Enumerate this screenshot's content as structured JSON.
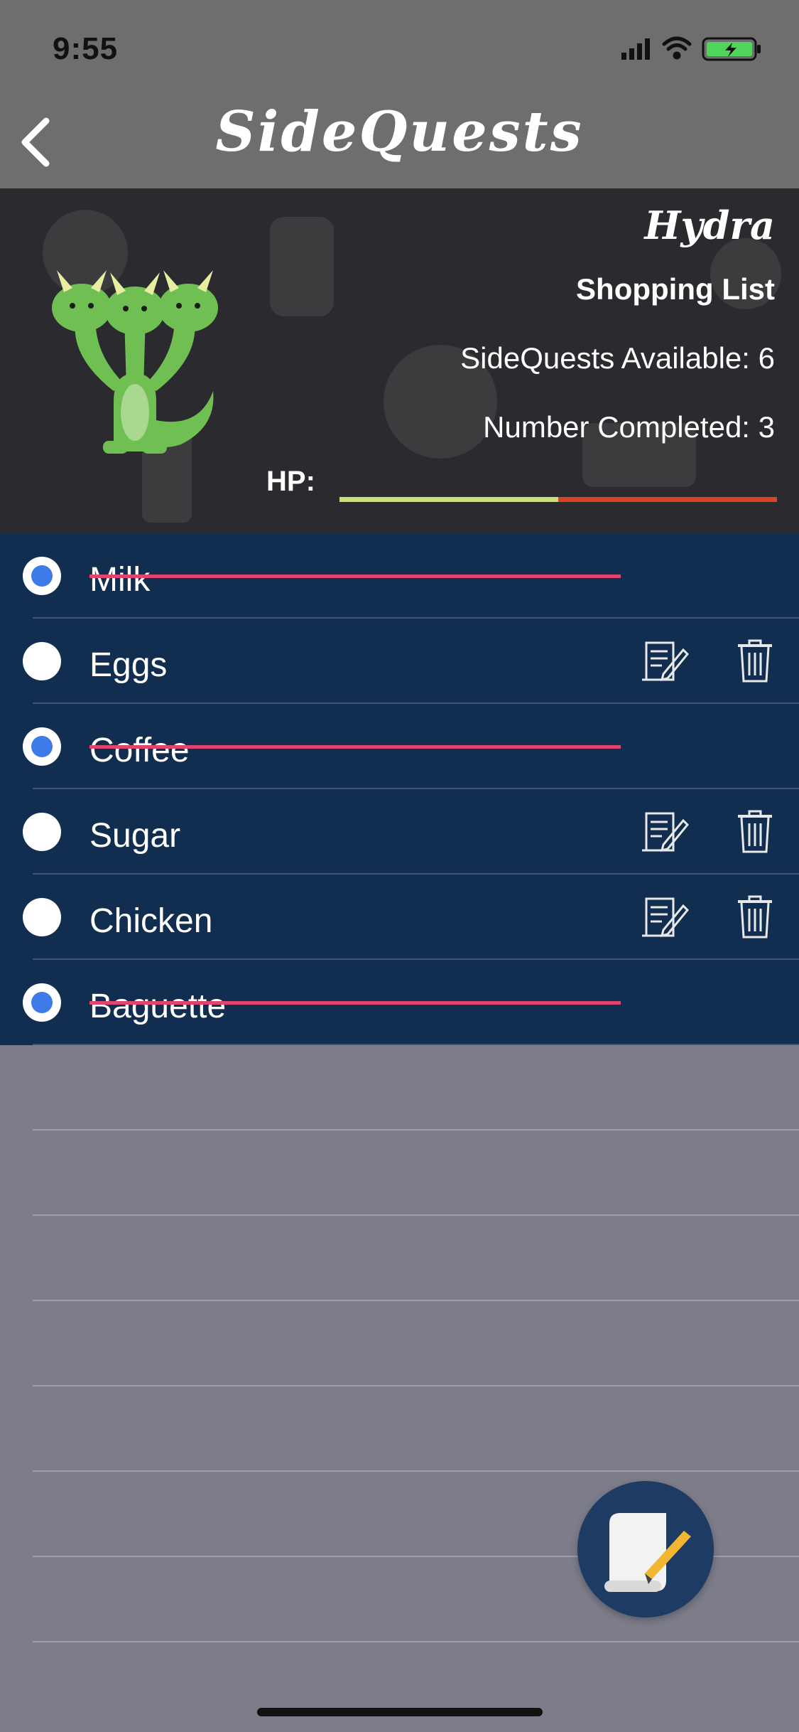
{
  "status": {
    "time": "9:55"
  },
  "nav": {
    "title": "SideQuests"
  },
  "header": {
    "monster_name": "Hydra",
    "list_name": "Shopping List",
    "available_text": "SideQuests Available: 6",
    "completed_text": "Number Completed: 3",
    "hp_label": "HP:",
    "hp_fraction": 0.5
  },
  "items": [
    {
      "label": "Milk",
      "completed": true
    },
    {
      "label": "Eggs",
      "completed": false
    },
    {
      "label": "Coffee",
      "completed": true
    },
    {
      "label": "Sugar",
      "completed": false
    },
    {
      "label": "Chicken",
      "completed": false
    },
    {
      "label": "Baguette",
      "completed": true
    }
  ],
  "colors": {
    "list_bg": "#112d4f",
    "strike": "#e0456d",
    "radio_selected": "#3c7be8",
    "hp_remaining": "#c7e07a",
    "hp_lost": "#d9451f",
    "monster": "#6fbf53"
  },
  "icons": [
    "back-chevron-icon",
    "location-arrow-icon",
    "signal-icon",
    "wifi-icon",
    "battery-icon",
    "edit-icon",
    "trash-icon",
    "scroll-quill-icon",
    "hydra-avatar"
  ]
}
